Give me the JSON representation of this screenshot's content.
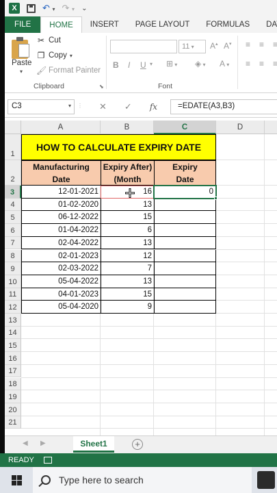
{
  "app": {
    "logo_letter": "X",
    "qat_more": "⌄"
  },
  "tabs": [
    {
      "label": "FILE"
    },
    {
      "label": "HOME"
    },
    {
      "label": "INSERT"
    },
    {
      "label": "PAGE LAYOUT"
    },
    {
      "label": "FORMULAS"
    },
    {
      "label": "DATA"
    }
  ],
  "ribbon": {
    "paste_label": "Paste",
    "cut_label": "Cut",
    "copy_label": "Copy",
    "format_painter_label": "Format Painter",
    "clipboard_group": "Clipboard",
    "font_group": "Font",
    "font_size": "11",
    "bold": "B",
    "italic": "I",
    "underline": "U"
  },
  "formula_bar": {
    "name_box": "C3",
    "formula": "=EDATE(A3,B3)",
    "fx": "fx"
  },
  "grid": {
    "columns": [
      "A",
      "B",
      "C",
      "D",
      "E"
    ],
    "rows": [
      "1",
      "2",
      "3",
      "4",
      "5",
      "6",
      "7",
      "8",
      "9",
      "10",
      "11",
      "12",
      "13",
      "14",
      "15",
      "16",
      "17",
      "18",
      "19",
      "20",
      "21"
    ],
    "title": "HOW TO CALCULATE EXPIRY DATE",
    "headers": {
      "a": "Manufacturing\nDate",
      "b": "Expiry After)\n(Month",
      "c": "Expiry\nDate"
    },
    "data": [
      {
        "a": "12-01-2021",
        "b": "16",
        "c": "0"
      },
      {
        "a": "01-02-2020",
        "b": "13",
        "c": ""
      },
      {
        "a": "06-12-2022",
        "b": "15",
        "c": ""
      },
      {
        "a": "01-04-2022",
        "b": "6",
        "c": ""
      },
      {
        "a": "02-04-2022",
        "b": "13",
        "c": ""
      },
      {
        "a": "02-01-2023",
        "b": "12",
        "c": ""
      },
      {
        "a": "02-03-2022",
        "b": "7",
        "c": ""
      },
      {
        "a": "05-04-2022",
        "b": "13",
        "c": ""
      },
      {
        "a": "04-01-2023",
        "b": "15",
        "c": ""
      },
      {
        "a": "05-04-2020",
        "b": "9",
        "c": ""
      }
    ]
  },
  "sheets": {
    "active": "Sheet1"
  },
  "status": {
    "mode": "READY"
  },
  "taskbar": {
    "search_placeholder": "Type here to search"
  }
}
